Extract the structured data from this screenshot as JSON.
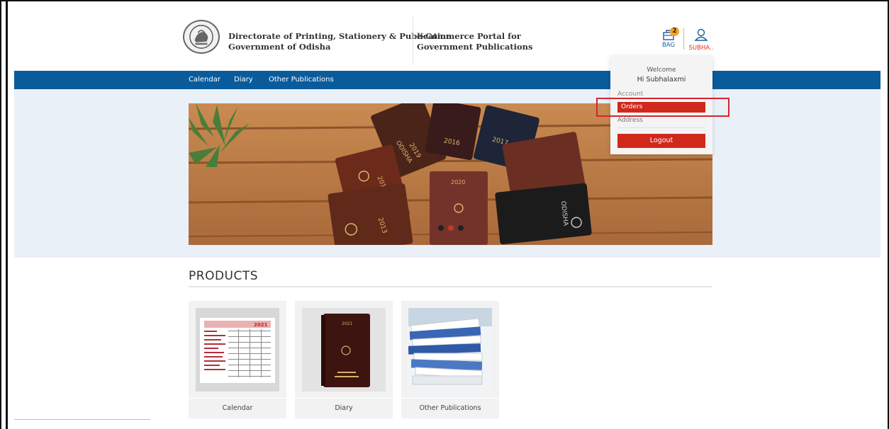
{
  "header": {
    "org_line1": "Directorate of Printing, Stationery & Publication",
    "org_line2": "Government of Odisha",
    "portal_line1": "e-Commerce Portal for",
    "portal_line2": "Government Publications",
    "bag_count": "2",
    "bag_label": "BAG",
    "user_label": "SUBHA.."
  },
  "nav": {
    "items": [
      "Calendar",
      "Diary",
      "Other Publications"
    ]
  },
  "user_menu": {
    "welcome": "Welcome",
    "greeting": "Hi Subhalaxmi",
    "account": "Account",
    "orders": "Orders",
    "address": "Address",
    "logout": "Logout"
  },
  "banner": {
    "slide_count": 3,
    "active_slide": 1,
    "diary_labels": [
      "ODISHA",
      "2019",
      "2016",
      "2017",
      "2014",
      "2020",
      "2013",
      "ODISHA"
    ]
  },
  "products": {
    "title": "PRODUCTS",
    "items": [
      {
        "label": "Calendar",
        "image_text": "2021"
      },
      {
        "label": "Diary",
        "image_text": "2021"
      },
      {
        "label": "Other Publications"
      }
    ]
  },
  "colors": {
    "nav_blue": "#0a5b9c",
    "accent_red": "#d0281b",
    "banner_bg": "#e9f0f8",
    "badge_orange": "#f5a623"
  }
}
